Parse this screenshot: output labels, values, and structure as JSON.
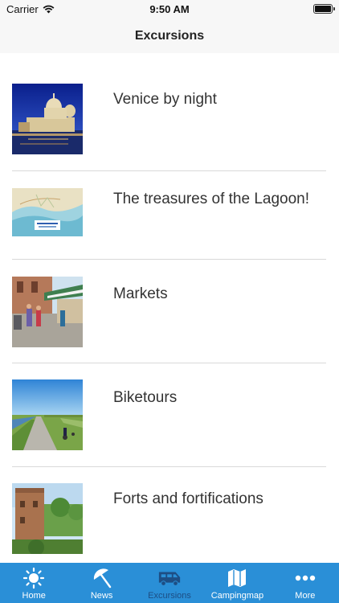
{
  "status_bar": {
    "carrier": "Carrier",
    "time": "9:50 AM"
  },
  "nav": {
    "title": "Excursions"
  },
  "items": [
    {
      "title": "Venice by night"
    },
    {
      "title": "The treasures of the Lagoon!"
    },
    {
      "title": "Markets"
    },
    {
      "title": "Biketours"
    },
    {
      "title": "Forts and fortifications"
    }
  ],
  "tabs": [
    {
      "label": "Home",
      "icon": "sun-icon",
      "active": false
    },
    {
      "label": "News",
      "icon": "umbrella-icon",
      "active": false
    },
    {
      "label": "Excursions",
      "icon": "van-icon",
      "active": true
    },
    {
      "label": "Campingmap",
      "icon": "map-icon",
      "active": false
    },
    {
      "label": "More",
      "icon": "more-icon",
      "active": false
    }
  ],
  "colors": {
    "tab_bar": "#2a8fd7",
    "active_tab": "#1d4e84",
    "bar_bg": "#f7f7f7"
  }
}
